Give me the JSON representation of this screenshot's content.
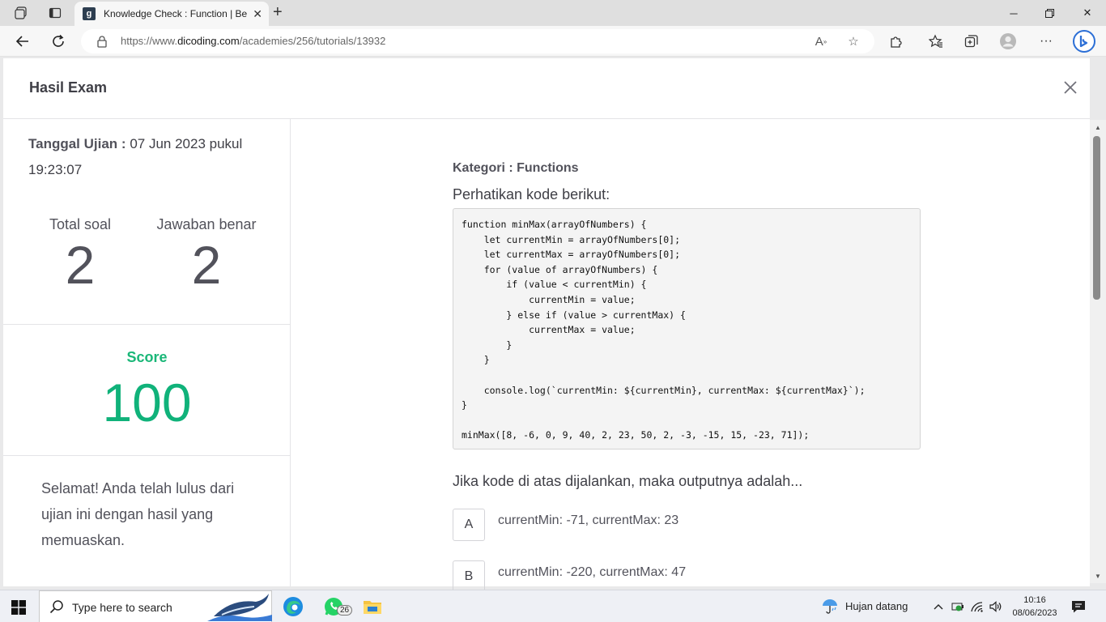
{
  "browser": {
    "tab_title": "Knowledge Check : Function | Bel",
    "favicon_letter": "g",
    "url_host_prefix": "https://www.",
    "url_host": "dicoding.com",
    "url_path": "/academies/256/tutorials/13932"
  },
  "modal": {
    "title": "Hasil Exam",
    "exam_date_label": "Tanggal Ujian :",
    "exam_date_value": "07 Jun 2023 pukul 19:23:07",
    "total_label": "Total soal",
    "total_value": "2",
    "correct_label": "Jawaban benar",
    "correct_value": "2",
    "score_label": "Score",
    "score_value": "100",
    "congrats": "Selamat! Anda telah lulus dari ujian ini dengan hasil yang memuaskan."
  },
  "question": {
    "category": "Kategori : Functions",
    "intro": "Perhatikan kode berikut:",
    "code": "function minMax(arrayOfNumbers) {\n    let currentMin = arrayOfNumbers[0];\n    let currentMax = arrayOfNumbers[0];\n    for (value of arrayOfNumbers) {\n        if (value < currentMin) {\n            currentMin = value;\n        } else if (value > currentMax) {\n            currentMax = value;\n        }\n    }\n\n    console.log(`currentMin: ${currentMin}, currentMax: ${currentMax}`);\n}\n\nminMax([8, -6, 0, 9, 40, 2, 23, 50, 2, -3, -15, 15, -23, 71]);",
    "prompt": "Jika kode di atas dijalankan, maka outputnya adalah...",
    "options": [
      {
        "letter": "A",
        "text": "currentMin: -71, currentMax: 23"
      },
      {
        "letter": "B",
        "text": "currentMin: -220, currentMax: 47"
      }
    ]
  },
  "taskbar": {
    "search_placeholder": "Type here to search",
    "whatsapp_badge": "26",
    "weather": "Hujan datang",
    "time": "10:16",
    "date": "08/06/2023"
  },
  "colors": {
    "score": "#10b27a",
    "accent": "#0078d4"
  }
}
